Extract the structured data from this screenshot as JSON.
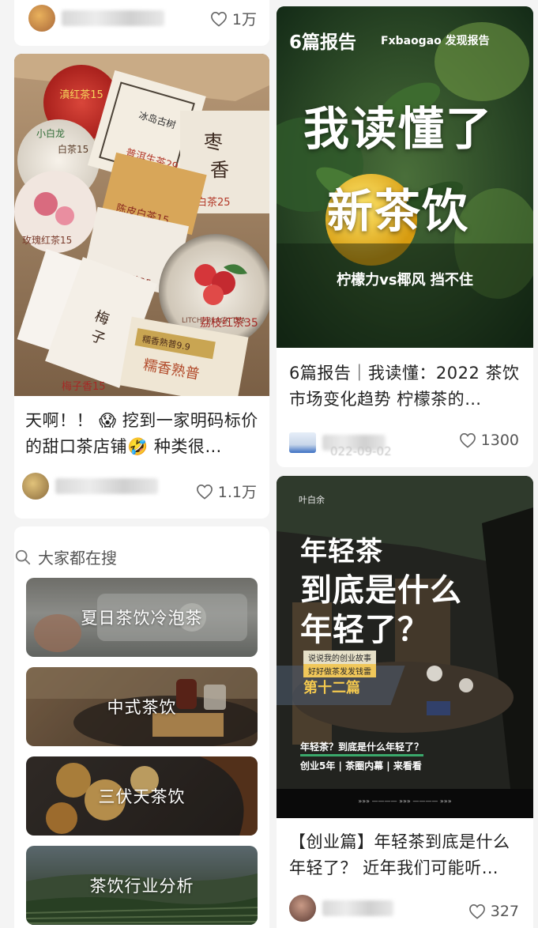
{
  "feed": {
    "top_left": {
      "likes": "1万"
    },
    "card_tea_box": {
      "cover_labels": [
        "滇红茶15",
        "冰岛古树",
        "普洱生茶29",
        "枣香白茶25",
        "小白龙",
        "白茶15",
        "玫瑰红茶15",
        "陈皮白茶15",
        "冰岛糯砖25",
        "梅子香15",
        "荔枝红茶35",
        "糯香熟普9.9",
        "糯香熟普",
        "LITCHI BLACK TEA"
      ],
      "title": "天啊！！ 😱 挖到一家明码标价的甜口茶店铺🤣 种类很…",
      "likes": "1.1万"
    },
    "card_report": {
      "cover_tag": "6篇报告",
      "cover_brand": "Fxbaogao 发现报告",
      "cover_headline_1": "我读懂了",
      "cover_headline_2": "新茶饮",
      "cover_subline": "柠檬力vs椰风 挡不住",
      "title": "6篇报告｜我读懂：2022 茶饮市场变化趋势 柠檬茶的…",
      "date_partial": "022-09-02",
      "likes": "1300"
    },
    "search_module": {
      "heading": "大家都在搜",
      "tiles": [
        {
          "label": "夏日茶饮冷泡茶"
        },
        {
          "label": "中式茶饮"
        },
        {
          "label": "三伏天茶饮"
        },
        {
          "label": "茶饮行业分析"
        }
      ]
    },
    "card_young_tea": {
      "cover_brand": "叶白余",
      "cover_headline_1": "年轻茶",
      "cover_headline_2": "到底是什么",
      "cover_headline_3": "年轻了？",
      "cover_tag_1": "说说我的创业故事",
      "cover_tag_2": "好好做茶发发钱雷",
      "cover_chapter": "第十二篇",
      "cover_bottom_1": "年轻茶？到底是什么年轻了？",
      "cover_bottom_2": "创业5年 | 茶圈内幕 | 来看看",
      "cover_arrows": "»»» ———— »»» ———— »»»",
      "title": "【创业篇】年轻茶到底是什么年轻了？ 近年我们可能听…",
      "likes": "327"
    }
  },
  "colors": {
    "background": "#f4f4f4",
    "card": "#ffffff",
    "text": "#222222",
    "muted": "#555555",
    "report_yellow": "#f2c230",
    "tile_overlay": "rgba(0,0,0,0.35)"
  }
}
